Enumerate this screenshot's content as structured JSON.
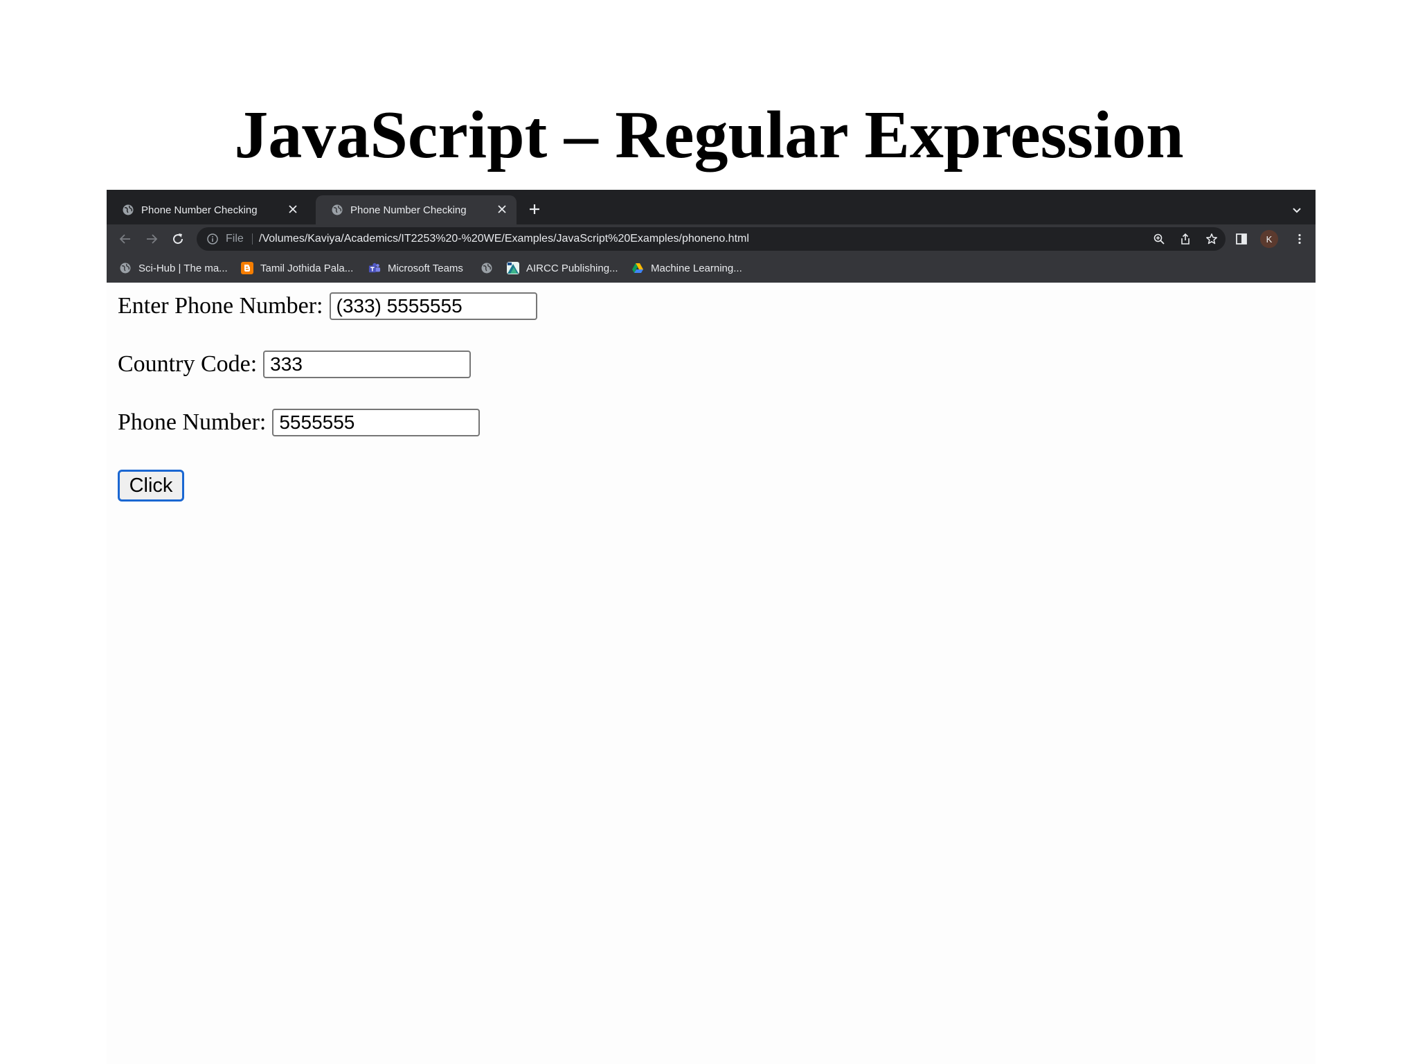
{
  "slide": {
    "title": "JavaScript – Regular Expression"
  },
  "browser": {
    "tabs": [
      {
        "label": "Phone Number Checking",
        "icon": "globe-icon",
        "active": false
      },
      {
        "label": "Phone Number Checking",
        "icon": "globe-icon",
        "active": true
      }
    ],
    "address_bar": {
      "scheme_label": "File",
      "url": "/Volumes/Kaviya/Academics/IT2253%20-%20WE/Examples/JavaScript%20Examples/phoneno.html"
    },
    "profile_initial": "K",
    "bookmarks": [
      {
        "label": "Sci-Hub | The ma...",
        "icon": "globe-icon"
      },
      {
        "label": "Tamil Jothida Pala...",
        "icon": "blogger-icon"
      },
      {
        "label": "Microsoft Teams",
        "icon": "teams-icon"
      },
      {
        "label": "",
        "icon": "globe-icon"
      },
      {
        "label": "AIRCC Publishing...",
        "icon": "aircc-icon"
      },
      {
        "label": "Machine Learning...",
        "icon": "drive-icon"
      }
    ]
  },
  "form": {
    "phone_input_label": "Enter Phone Number:",
    "phone_input_value": "(333) 5555555",
    "country_code_label": "Country Code:",
    "country_code_value": "333",
    "phone_number_label": "Phone Number:",
    "phone_number_value": "5555555",
    "submit_label": "Click"
  },
  "colors": {
    "browser_dark": "#202124",
    "toolbar": "#35363a",
    "focus_blue": "#1a67d2"
  }
}
